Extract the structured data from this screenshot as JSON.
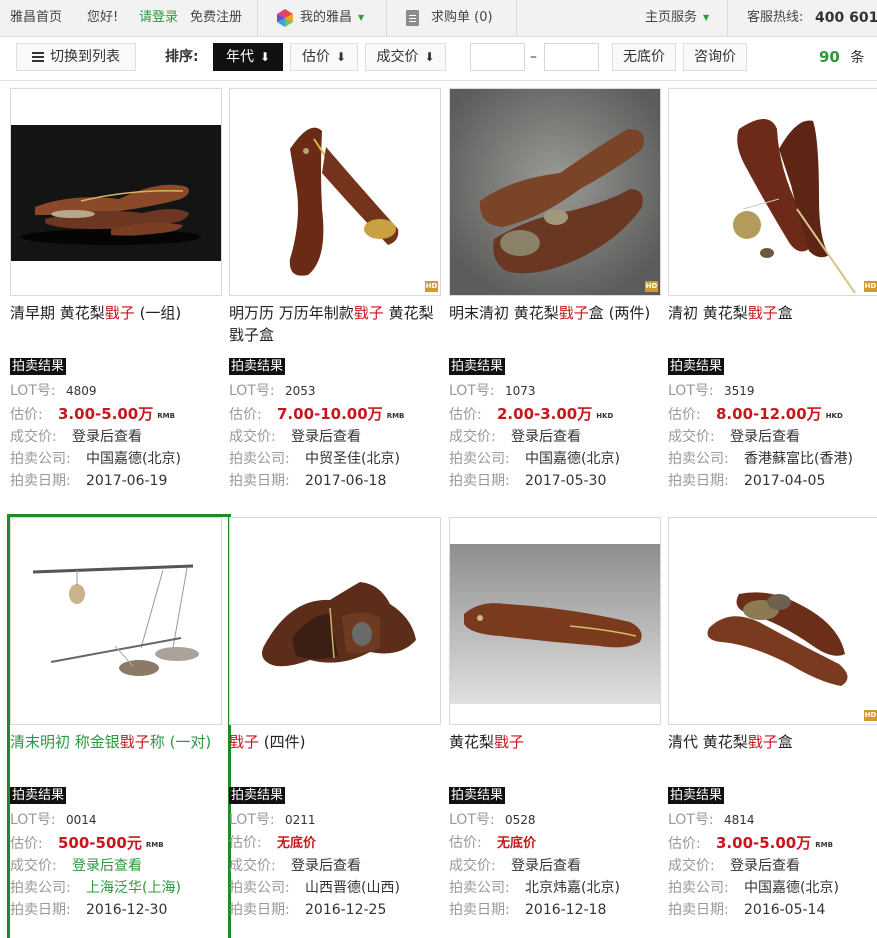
{
  "topnav": {
    "home": "雅昌首页",
    "greeting": "您好!",
    "login": "请登录",
    "register": "免费注册",
    "my_artron": "我的雅昌",
    "wishlist": "求购单 (0)",
    "homepage_service": "主页服务",
    "hotline_label": "客服热线:",
    "hotline_number": "400 601"
  },
  "toolbar": {
    "switch_list": "切换到列表",
    "sort_label": "排序:",
    "sort_options": [
      "年代",
      "估价",
      "成交价"
    ],
    "active_sort": "年代",
    "range_from_value": "",
    "range_to_value": "",
    "range_dash": "–",
    "no_reserve": "无底价",
    "inquiry": "咨询价",
    "count": "90",
    "count_unit": "条"
  },
  "labels": {
    "result_badge": "拍卖结果",
    "lot": "LOT号:",
    "estimate": "估价:",
    "deal": "成交价:",
    "company": "拍卖公司:",
    "date": "拍卖日期:"
  },
  "items": [
    {
      "title_pre": "清早期 黄花梨",
      "title_kw": "戥子",
      "title_post": " (一组)",
      "lot": "4809",
      "estimate": "3.00-5.00万",
      "currency": "RMB",
      "deal": "登录后查看",
      "company": "中国嘉德(北京)",
      "date": "2017-06-19",
      "hd": false
    },
    {
      "title_pre": "明万历 万历年制款",
      "title_kw": "戥子",
      "title_post": " 黄花梨戥子盒",
      "lot": "2053",
      "estimate": "7.00-10.00万",
      "currency": "RMB",
      "deal": "登录后查看",
      "company": "中贸圣佳(北京)",
      "date": "2017-06-18",
      "hd": true
    },
    {
      "title_pre": "明末清初 黄花梨",
      "title_kw": "戥子",
      "title_post": "盒 (两件)",
      "lot": "1073",
      "estimate": "2.00-3.00万",
      "currency": "HKD",
      "deal": "登录后查看",
      "company": "中国嘉德(北京)",
      "date": "2017-05-30",
      "hd": true
    },
    {
      "title_pre": "清初 黄花梨",
      "title_kw": "戥子",
      "title_post": "盒",
      "lot": "3519",
      "estimate": "8.00-12.00万",
      "currency": "HKD",
      "deal": "登录后查看",
      "company": "香港蘇富比(香港)",
      "date": "2017-04-05",
      "hd": true
    },
    {
      "title_pre": "清末明初 称金银",
      "title_kw": "戥子",
      "title_post": "称 (一对)",
      "lot": "0014",
      "estimate": "500-500元",
      "currency": "RMB",
      "deal": "登录后查看",
      "company": "上海泛华(上海)",
      "date": "2016-12-30",
      "hd": false,
      "selected": true
    },
    {
      "title_pre": "",
      "title_kw": "戥子",
      "title_post": " (四件)",
      "lot": "0211",
      "estimate": "无底价",
      "currency": "",
      "deal": "登录后查看",
      "company": "山西晋德(山西)",
      "date": "2016-12-25",
      "hd": false
    },
    {
      "title_pre": "黄花梨",
      "title_kw": "戥子",
      "title_post": "",
      "lot": "0528",
      "estimate": "无底价",
      "currency": "",
      "deal": "登录后查看",
      "company": "北京炜嘉(北京)",
      "date": "2016-12-18",
      "hd": false
    },
    {
      "title_pre": "清代 黄花梨",
      "title_kw": "戥子",
      "title_post": "盒",
      "lot": "4814",
      "estimate": "3.00-5.00万",
      "currency": "RMB",
      "deal": "登录后查看",
      "company": "中国嘉德(北京)",
      "date": "2016-05-14",
      "hd": true
    }
  ],
  "colors": {
    "accent_green": "#2b9a3e",
    "keyword_red": "#c8161d",
    "selected_border": "#1f8a2a"
  }
}
